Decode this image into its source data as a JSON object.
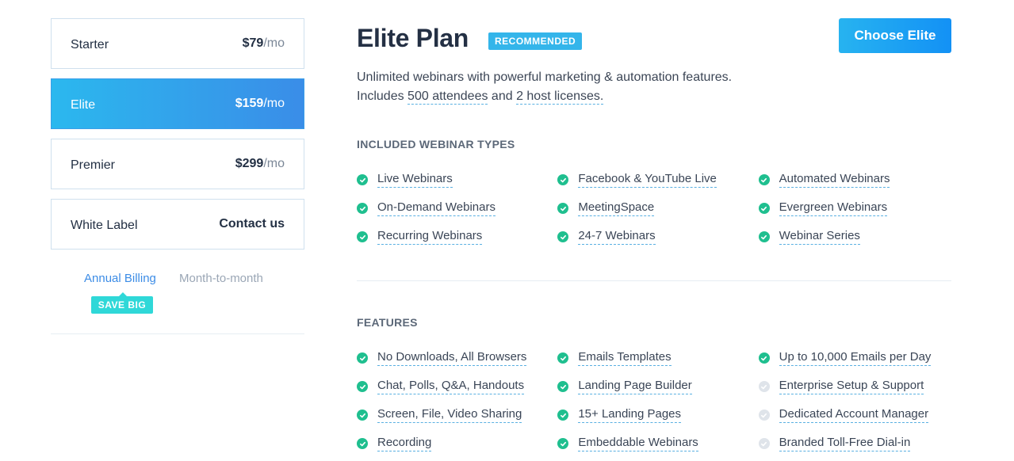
{
  "plans": [
    {
      "name": "Starter",
      "amount": "$79",
      "unit": "/mo",
      "active": false
    },
    {
      "name": "Elite",
      "amount": "$159",
      "unit": "/mo",
      "active": true
    },
    {
      "name": "Premier",
      "amount": "$299",
      "unit": "/mo",
      "active": false
    },
    {
      "name": "White Label",
      "amount": "Contact us",
      "unit": "",
      "active": false
    }
  ],
  "billing": {
    "annual_label": "Annual Billing",
    "monthly_label": "Month-to-month",
    "save_badge": "SAVE BIG"
  },
  "detail": {
    "title": "Elite Plan",
    "badge": "RECOMMENDED",
    "cta": "Choose Elite",
    "desc_line1": "Unlimited webinars with powerful marketing & automation features.",
    "desc_prefix": "Includes ",
    "attendees": "500 attendees",
    "and": " and ",
    "hosts": "2 host licenses.",
    "types_title": "INCLUDED WEBINAR TYPES",
    "features_title": "FEATURES"
  },
  "webinar_types": [
    [
      {
        "label": "Live Webinars",
        "included": true
      },
      {
        "label": "Facebook & YouTube Live",
        "included": true
      },
      {
        "label": "Automated Webinars",
        "included": true
      }
    ],
    [
      {
        "label": "On-Demand Webinars",
        "included": true
      },
      {
        "label": "MeetingSpace",
        "included": true
      },
      {
        "label": "Evergreen Webinars",
        "included": true
      }
    ],
    [
      {
        "label": "Recurring Webinars",
        "included": true
      },
      {
        "label": "24-7 Webinars",
        "included": true
      },
      {
        "label": "Webinar Series",
        "included": true
      }
    ]
  ],
  "features": [
    [
      {
        "label": "No Downloads, All Browsers",
        "included": true
      },
      {
        "label": "Emails Templates",
        "included": true
      },
      {
        "label": "Up to 10,000 Emails per Day",
        "included": true
      }
    ],
    [
      {
        "label": "Chat, Polls, Q&A, Handouts",
        "included": true
      },
      {
        "label": "Landing Page Builder",
        "included": true
      },
      {
        "label": "Enterprise Setup & Support",
        "included": false
      }
    ],
    [
      {
        "label": "Screen, File, Video Sharing",
        "included": true
      },
      {
        "label": "15+ Landing Pages",
        "included": true
      },
      {
        "label": "Dedicated Account Manager",
        "included": false
      }
    ],
    [
      {
        "label": "Recording",
        "included": true
      },
      {
        "label": "Embeddable Webinars",
        "included": true
      },
      {
        "label": "Branded Toll-Free Dial-in",
        "included": false
      }
    ]
  ],
  "colors": {
    "accent": "#34b5ea",
    "check_on": "#1fbf8f",
    "check_off": "#dfe4ea"
  }
}
